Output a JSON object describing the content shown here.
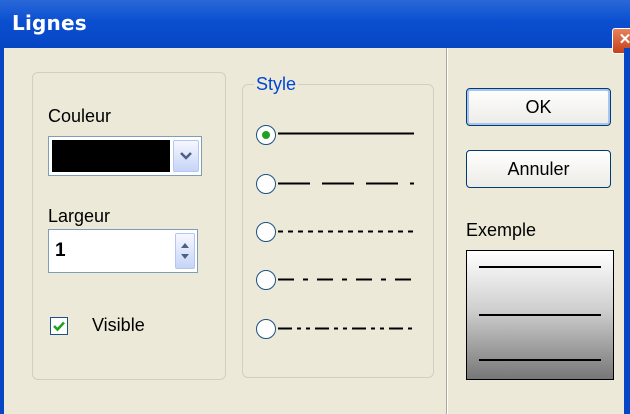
{
  "window": {
    "title": "Lignes",
    "close_glyph": "✕"
  },
  "left_panel": {
    "color_label": "Couleur",
    "color_value": "#000000",
    "width_label": "Largeur",
    "width_value": "1",
    "visible_label": "Visible",
    "visible_checked": true
  },
  "style_group": {
    "title": "Style",
    "options": [
      {
        "pattern": "solid",
        "selected": true
      },
      {
        "pattern": "long-dash",
        "selected": false
      },
      {
        "pattern": "dotted",
        "selected": false
      },
      {
        "pattern": "dash-dot",
        "selected": false
      },
      {
        "pattern": "dash-dot-dot",
        "selected": false
      }
    ]
  },
  "buttons": {
    "ok_label": "OK",
    "cancel_label": "Annuler"
  },
  "preview": {
    "label": "Exemple"
  },
  "colors": {
    "titlebar": "#0646c4",
    "dialog_bg": "#ece9d8",
    "radio_selected": "#21a121"
  }
}
